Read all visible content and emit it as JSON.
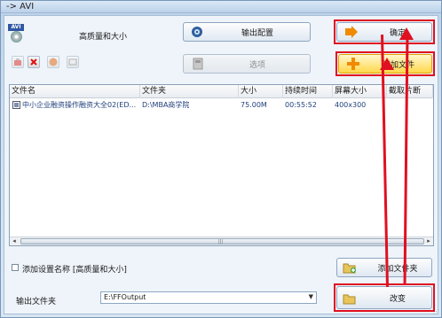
{
  "window": {
    "title": "-> AVI"
  },
  "format": {
    "badge": "AVI",
    "quality_label": "高质量和大小"
  },
  "buttons": {
    "output_config": "输出配置",
    "confirm": "确定",
    "options": "选项",
    "add_file": "添加文件",
    "add_folder": "添加文件夹",
    "change": "改变"
  },
  "table": {
    "headers": [
      "文件名",
      "文件夹",
      "大小",
      "持续时间",
      "屏幕大小",
      "截取片断"
    ],
    "rows": [
      {
        "name": "中小企业融资操作融资大全02(ED...",
        "folder": "D:\\MBA商学院",
        "size": "75.00M",
        "duration": "00:55:52",
        "screen": "400x300",
        "clip": ""
      }
    ]
  },
  "options": {
    "append_setting_label": "添加设置名称 [高质量和大小]",
    "append_setting_checked": false
  },
  "output": {
    "folder_label": "输出文件夹",
    "folder_value": "E:\\FFOutput"
  },
  "colors": {
    "highlight": "#e01020",
    "accent_yellow": "#ffd84a"
  }
}
